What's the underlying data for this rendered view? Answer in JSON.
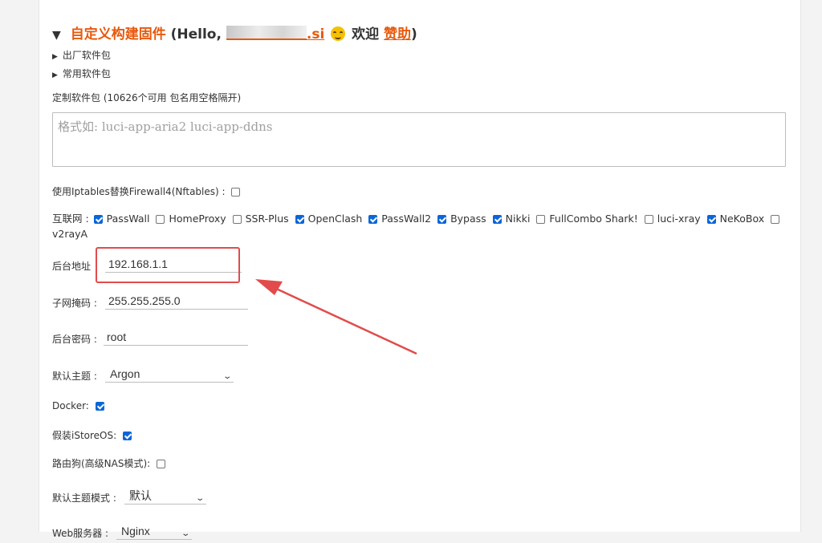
{
  "header_cut": {
    "text": "",
    "underline_text": ""
  },
  "title": {
    "label": "自定义构建固件",
    "hello_prefix": "(Hello,",
    "name_suffix": ".si",
    "welcome": "欢迎",
    "sponsor_link": "赞助",
    "close_paren": ")"
  },
  "sections": {
    "factory_packages": "出厂软件包",
    "common_packages": "常用软件包"
  },
  "custom_packages": {
    "label": "定制软件包 (10626个可用 包名用空格隔开)",
    "placeholder": "格式如: luci-app-aria2 luci-app-ddns",
    "value": ""
  },
  "iptables": {
    "label": "使用Iptables替换Firewall4(Nftables) :",
    "checked": false
  },
  "internet": {
    "label": "互联网 :",
    "items": [
      {
        "name": "PassWall",
        "checked": true
      },
      {
        "name": "HomeProxy",
        "checked": false
      },
      {
        "name": "SSR-Plus",
        "checked": false
      },
      {
        "name": "OpenClash",
        "checked": true
      },
      {
        "name": "PassWall2",
        "checked": true
      },
      {
        "name": "Bypass",
        "checked": true
      },
      {
        "name": "Nikki",
        "checked": true
      },
      {
        "name": "FullCombo Shark!",
        "checked": false
      },
      {
        "name": "luci-xray",
        "checked": false
      },
      {
        "name": "NeKoBox",
        "checked": true
      },
      {
        "name": "v2rayA",
        "checked": false
      }
    ]
  },
  "fields": {
    "admin_address": {
      "label": "后台地址",
      "value": "192.168.1.1"
    },
    "subnet_mask": {
      "label": "子网掩码 :",
      "value": "255.255.255.0"
    },
    "admin_password": {
      "label": "后台密码 :",
      "value": "root"
    },
    "default_theme": {
      "label": "默认主题 :",
      "value": "Argon"
    },
    "docker": {
      "label": "Docker:",
      "checked": true
    },
    "fake_istoreos": {
      "label": "假装iStoreOS:",
      "checked": true
    },
    "router_dog": {
      "label": "路由狗(高级NAS模式):",
      "checked": false
    },
    "theme_mode": {
      "label": "默认主题模式 :",
      "value": "默认"
    },
    "web_server": {
      "label": "Web服务器 :",
      "value": "Nginx"
    }
  },
  "colors": {
    "accent": "#e8590c",
    "annotation_red": "#e24b4b",
    "checkbox_blue": "#0a66d8"
  }
}
